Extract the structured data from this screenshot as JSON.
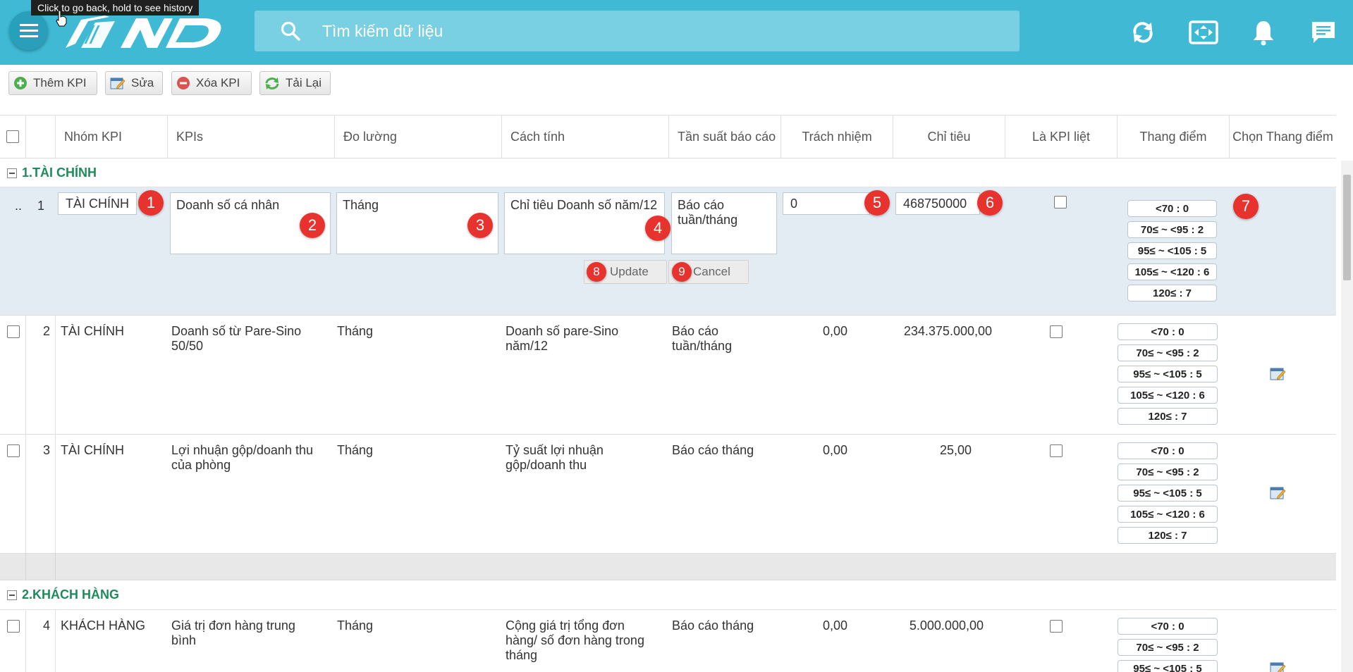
{
  "browser": {
    "back_tooltip": "Click to go back, hold to see history"
  },
  "header": {
    "search_placeholder": "Tìm kiếm dữ liệu",
    "icons": [
      "refresh-icon",
      "fullscreen-icon",
      "bell-icon",
      "chat-icon"
    ],
    "color": "#3fb9d4"
  },
  "toolbar": {
    "add_label": "Thêm KPI",
    "edit_label": "Sửa",
    "delete_label": "Xóa KPI",
    "reload_label": "Tải Lại"
  },
  "columns": {
    "group": "Nhóm KPI",
    "kpis": "KPIs",
    "measure": "Đo lường",
    "calc": "Cách tính",
    "freq": "Tần suất báo cáo",
    "resp": "Trách nhiệm",
    "target": "Chỉ tiêu",
    "critical": "Là KPI liệt",
    "scale": "Thang điểm",
    "choose_scale": "Chọn Thang điểm"
  },
  "groups": [
    {
      "label": "1.TÀI CHÍNH"
    },
    {
      "label": "2.KHÁCH HÀNG"
    }
  ],
  "edit_row": {
    "prefix": "..",
    "index": "1",
    "group": "TÀI CHÍNH",
    "kpi": "Doanh số cá nhân",
    "measure": "Tháng",
    "calc": "Chỉ tiêu Doanh số năm/12",
    "freq": "Báo cáo tuần/tháng",
    "resp": "0",
    "target": "468750000",
    "update_label": "Update",
    "cancel_label": "Cancel",
    "badges": [
      "1",
      "2",
      "3",
      "4",
      "5",
      "6",
      "7",
      "8",
      "9"
    ]
  },
  "scale_items": [
    "<70 : 0",
    "70≤ ~ <95 : 2",
    "95≤ ~ <105 : 5",
    "105≤ ~ <120 : 6",
    "120≤ : 7"
  ],
  "rows": [
    {
      "index": "2",
      "group": "TÀI CHÍNH",
      "kpi": "Doanh số từ Pare-Sino 50/50",
      "measure": "Tháng",
      "calc": "Doanh số pare-Sino năm/12",
      "freq": "Báo cáo tuần/tháng",
      "resp": "0,00",
      "target": "234.375.000,00"
    },
    {
      "index": "3",
      "group": "TÀI CHÍNH",
      "kpi": "Lợi nhuận gộp/doanh thu của phòng",
      "measure": "Tháng",
      "calc": "Tỷ suất lợi nhuận gộp/doanh thu",
      "freq": "Báo cáo tháng",
      "resp": "0,00",
      "target": "25,00"
    },
    {
      "index": "4",
      "group": "KHÁCH HÀNG",
      "kpi": "Giá trị đơn hàng trung bình",
      "measure": "Tháng",
      "calc": "Cộng giá trị tổng đơn hàng/ số đơn hàng trong tháng",
      "freq": "Báo cáo tháng",
      "resp": "0,00",
      "target": "5.000.000,00"
    }
  ]
}
